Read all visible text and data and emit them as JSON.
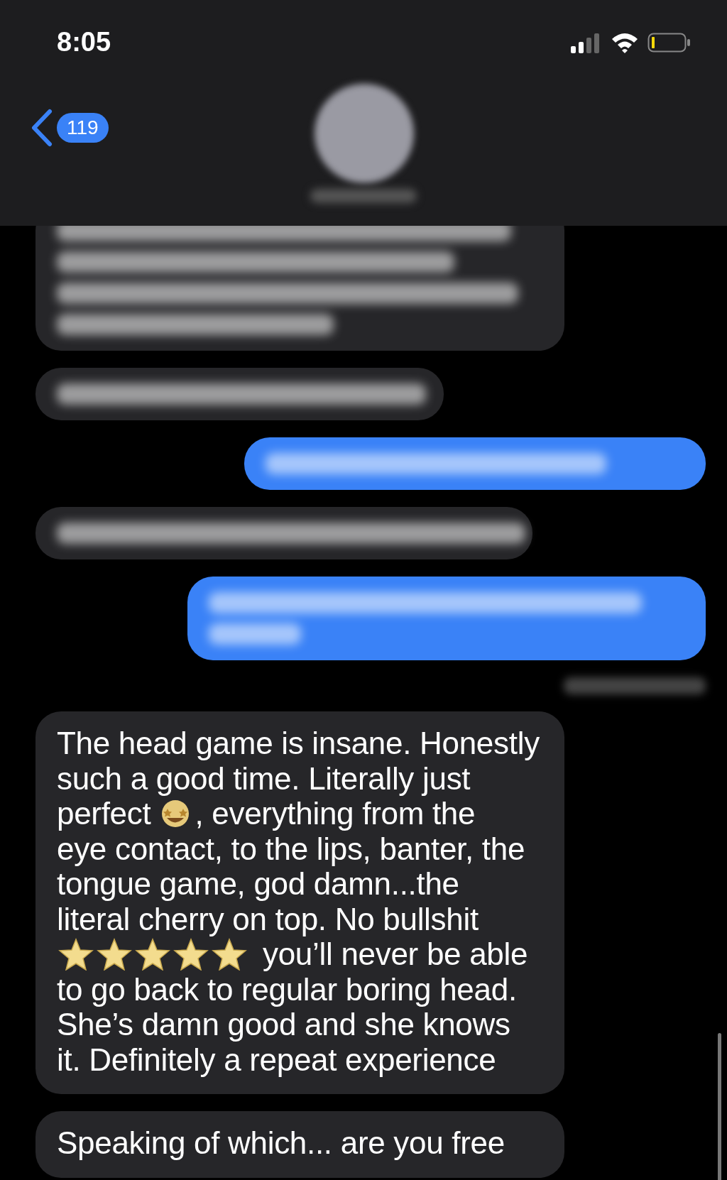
{
  "status_bar": {
    "time": "8:05"
  },
  "header": {
    "back_badge": "119"
  },
  "messages": [
    {
      "kind": "blurred",
      "outgoing": false
    },
    {
      "kind": "blurred",
      "outgoing": false
    },
    {
      "kind": "blurred",
      "outgoing": true
    },
    {
      "kind": "blurred",
      "outgoing": false
    },
    {
      "kind": "blurred",
      "outgoing": true
    },
    {
      "kind": "receipt"
    },
    {
      "kind": "text",
      "outgoing": false,
      "lines": [
        [
          {
            "kind": "text",
            "text": "The head game is insane. Honestly"
          }
        ],
        [
          {
            "kind": "text",
            "text": "such a good time. Literally just"
          }
        ],
        [
          {
            "kind": "text",
            "text": "perfect"
          },
          {
            "kind": "face"
          },
          {
            "kind": "text",
            "text": ", everything from the"
          }
        ],
        [
          {
            "kind": "text",
            "text": "eye contact, to the lips, banter, the"
          }
        ],
        [
          {
            "kind": "text",
            "text": "tongue game, god damn...the"
          }
        ],
        [
          {
            "kind": "text",
            "text": "literal cherry on top. No bullshit"
          }
        ],
        [
          {
            "kind": "stars",
            "stars": 5
          },
          {
            "kind": "text",
            "text": "you’ll never be able"
          }
        ],
        [
          {
            "kind": "text",
            "text": "to go back to regular boring head."
          }
        ],
        [
          {
            "kind": "text",
            "text": "She’s damn good and she knows"
          }
        ],
        [
          {
            "kind": "text",
            "text": "it. Definitely a repeat experience"
          }
        ]
      ]
    },
    {
      "kind": "text",
      "outgoing": false,
      "lines": [
        [
          {
            "kind": "text",
            "text": "Speaking of which... are you free"
          }
        ]
      ]
    }
  ]
}
